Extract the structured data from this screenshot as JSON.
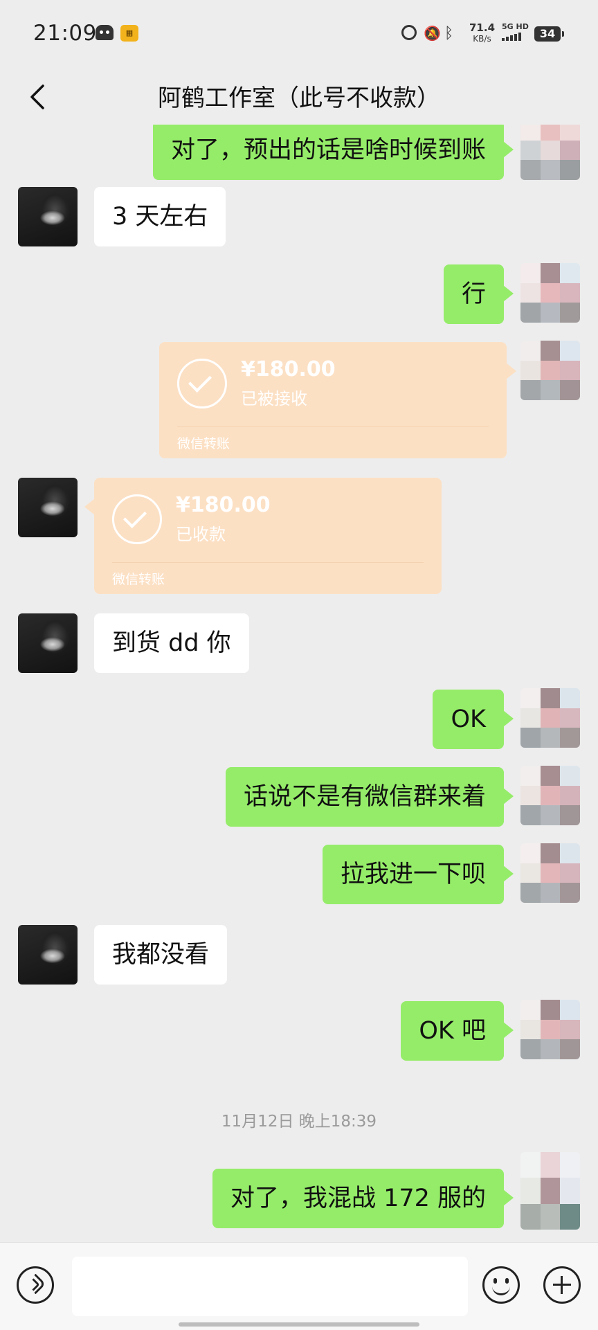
{
  "status_bar": {
    "time": "21:09",
    "net_speed_value": "71.4",
    "net_speed_unit": "KB/s",
    "network_label": "5G HD",
    "battery": "34",
    "icons": [
      "app-icon",
      "app-badge-icon",
      "alarm-icon",
      "mute-icon",
      "bluetooth-icon",
      "signal-icon",
      "battery-icon"
    ]
  },
  "header": {
    "title": "阿鹤工作室（此号不收款）",
    "back_icon": "chevron-left-icon"
  },
  "messages": [
    {
      "side": "self",
      "type": "text",
      "text": "对了，预出的话是啥时候到账"
    },
    {
      "side": "other",
      "type": "text",
      "text": "3 天左右"
    },
    {
      "side": "self",
      "type": "text",
      "text": "行"
    },
    {
      "side": "self",
      "type": "transfer",
      "amount": "¥180.00",
      "status": "已被接收",
      "label": "微信转账"
    },
    {
      "side": "other",
      "type": "transfer",
      "amount": "¥180.00",
      "status": "已收款",
      "label": "微信转账"
    },
    {
      "side": "other",
      "type": "text",
      "text": "到货 dd 你"
    },
    {
      "side": "self",
      "type": "text",
      "text": "OK"
    },
    {
      "side": "self",
      "type": "text",
      "text": "话说不是有微信群来着"
    },
    {
      "side": "self",
      "type": "text",
      "text": "拉我进一下呗"
    },
    {
      "side": "other",
      "type": "text",
      "text": "我都没看"
    },
    {
      "side": "self",
      "type": "text",
      "text": "OK 吧"
    },
    {
      "type": "timestamp",
      "text": "11月12日 晚上18:39"
    },
    {
      "side": "self",
      "type": "text",
      "text": "对了，我混战 172 服的"
    }
  ],
  "input_bar": {
    "value": "",
    "icons": [
      "voice-icon",
      "emoji-icon",
      "plus-icon"
    ]
  },
  "colors": {
    "background": "#ededed",
    "self_bubble": "#95ec69",
    "other_bubble": "#ffffff",
    "transfer_card": "#fce0c4",
    "timestamp": "#9a9a9a"
  }
}
